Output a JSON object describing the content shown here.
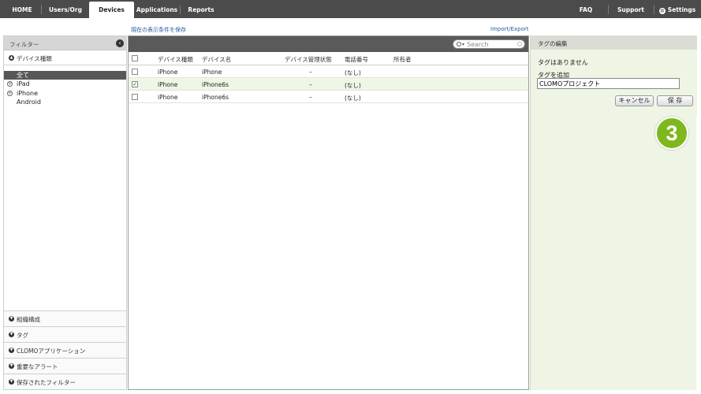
{
  "nav": {
    "items": [
      {
        "label": "HOME"
      },
      {
        "label": "Users/Org"
      },
      {
        "label": "Devices"
      },
      {
        "label": "Applications"
      },
      {
        "label": "Reports"
      }
    ],
    "right": [
      {
        "label": "FAQ"
      },
      {
        "label": "Support"
      },
      {
        "label": "Settings"
      }
    ],
    "active": "Devices"
  },
  "links": {
    "save_view": "現在の表示条件を保存",
    "import_export": "Import/Export"
  },
  "filter": {
    "title": "フィルター",
    "device_type_section": "デバイス種類",
    "items": [
      "全て",
      "iPad",
      "iPhone",
      "Android"
    ],
    "bottom_sections": [
      "組織構成",
      "タグ",
      "CLOMOアプリケーション",
      "重要なアラート",
      "保存されたフィルター"
    ]
  },
  "table": {
    "search_placeholder": "Search",
    "headers": [
      "デバイス種類",
      "デバイス名",
      "デバイス管理状態",
      "電話番号",
      "所有者"
    ],
    "rows": [
      {
        "type": "iPhone",
        "name": "iPhone",
        "status": "–",
        "phone": "(なし)",
        "owner": "",
        "checked": false
      },
      {
        "type": "iPhone",
        "name": "iPhone6s",
        "status": "–",
        "phone": "(なし)",
        "owner": "",
        "checked": true
      },
      {
        "type": "iPhone",
        "name": "iPhone6s",
        "status": "–",
        "phone": "(なし)",
        "owner": "",
        "checked": false
      }
    ]
  },
  "tag_panel": {
    "title": "タグの編集",
    "no_tags": "タグはありません",
    "add_label": "タグを追加",
    "input_value": "CLOMOプロジェクト",
    "cancel_label": "キャンセル",
    "save_label": "保 存"
  },
  "callout": {
    "number": "3",
    "color": "#7fb81e"
  }
}
